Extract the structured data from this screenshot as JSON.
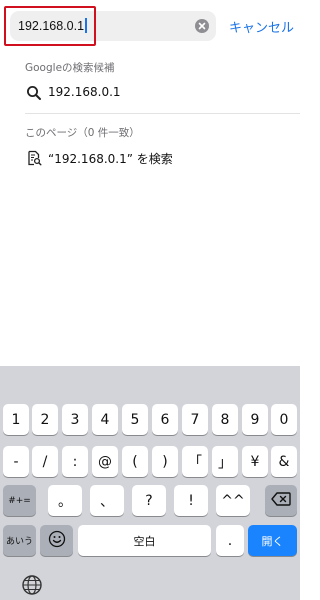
{
  "search": {
    "value": "192.168.0.1",
    "cancel_label": "キャンセル"
  },
  "google_section": {
    "header": "Googleの検索候補",
    "suggestion": "192.168.0.1"
  },
  "page_section": {
    "header": "このページ（0 件一致）",
    "find_label": "“192.168.0.1” を検索"
  },
  "keyboard": {
    "row1": [
      "1",
      "2",
      "3",
      "4",
      "5",
      "6",
      "7",
      "8",
      "9",
      "0"
    ],
    "row2": [
      "-",
      "/",
      ":",
      "@",
      "(",
      ")",
      "「",
      "」",
      "¥",
      "&"
    ],
    "row3": {
      "mode_key": "#+=",
      "keys": [
        "。",
        "、",
        "?",
        "!",
        "^^"
      ],
      "backspace_icon": "backspace-icon"
    },
    "row4": {
      "kana_key": "あいう",
      "emoji_icon": "emoji-icon",
      "space_label": "空白",
      "period": ".",
      "return_label": "開く"
    },
    "globe_icon": "globe-icon"
  },
  "colors": {
    "accent": "#1a73e8",
    "highlight": "#d0101e",
    "return_key": "#1a84ff",
    "keyboard_bg": "#d2d4d9"
  }
}
